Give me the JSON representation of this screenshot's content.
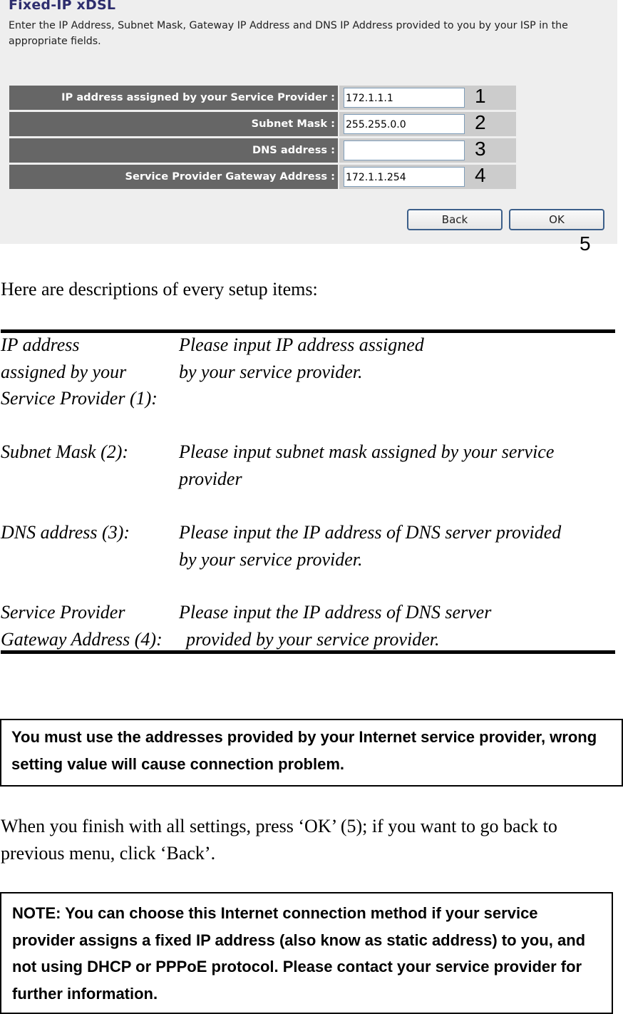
{
  "screenshot": {
    "title": "Fixed-IP xDSL",
    "description": "Enter the IP Address, Subnet Mask, Gateway IP Address and DNS IP Address provided to you by your ISP in the appropriate fields.",
    "fields": [
      {
        "label": "IP address assigned by your Service Provider :",
        "value": "172.1.1.1",
        "callout": "1"
      },
      {
        "label": "Subnet Mask :",
        "value": "255.255.0.0",
        "callout": "2"
      },
      {
        "label": "DNS address :",
        "value": "",
        "callout": "3"
      },
      {
        "label": "Service Provider Gateway Address :",
        "value": "172.1.1.254",
        "callout": "4"
      }
    ],
    "buttons": {
      "back": "Back",
      "ok": "OK"
    },
    "ok_callout": "5"
  },
  "manual": {
    "intro": "Here are descriptions of every setup items:",
    "definitions": [
      {
        "term": "IP address\nassigned by your\nService Provider (1):",
        "desc": "Please input IP address assigned\nby your service provider."
      },
      {
        "term": "Subnet Mask (2):",
        "desc": "Please input subnet mask assigned by your service\nprovider"
      },
      {
        "term": "DNS address (3):",
        "desc": "Please input the IP address of DNS server provided\nby your service provider."
      },
      {
        "term": "Service Provider\nGateway Address (4):",
        "desc": "Please input the IP address of DNS server\n provided by your service provider."
      }
    ],
    "warning": "You must use the addresses provided by your Internet service provider, wrong setting value will cause connection problem.",
    "finish": "When you finish with all settings, press ‘OK’ (5); if you want to go back to previous menu, click ‘Back’.",
    "note": "NOTE: You can choose this Internet connection method if your service provider assigns a fixed IP address (also know as static address) to you, and not using DHCP or PPPoE protocol. Please contact your service provider for further information."
  }
}
